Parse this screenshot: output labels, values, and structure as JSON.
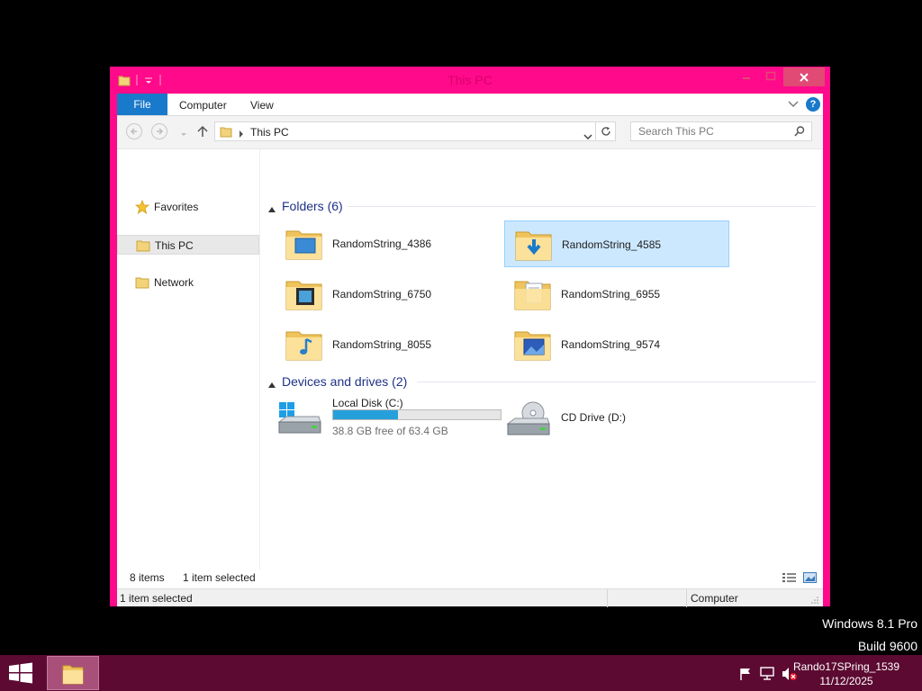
{
  "window": {
    "title": "This PC",
    "colors": {
      "frame": "#ff0a8a",
      "accent": "#1979ca",
      "selection": "#cce8ff"
    }
  },
  "ribbon": {
    "tabs": [
      {
        "label": "File",
        "active": true
      },
      {
        "label": "Computer"
      },
      {
        "label": "View"
      }
    ],
    "help_icon": "?"
  },
  "navbar": {
    "address": "This PC",
    "search_placeholder": "Search This PC"
  },
  "navpane": {
    "items": [
      {
        "label": "Favorites",
        "icon": "star-icon"
      },
      {
        "label": "This PC",
        "icon": "folder-icon",
        "selected": true
      },
      {
        "label": "Network",
        "icon": "folder-icon"
      }
    ]
  },
  "content": {
    "folders_group": {
      "title": "Folders (6)"
    },
    "folders": [
      {
        "name": "RandomString_4386",
        "icon": "desktop-folder-icon"
      },
      {
        "name": "RandomString_4585",
        "icon": "downloads-folder-icon",
        "selected": true
      },
      {
        "name": "RandomString_6750",
        "icon": "videos-folder-icon"
      },
      {
        "name": "RandomString_6955",
        "icon": "documents-folder-icon"
      },
      {
        "name": "RandomString_8055",
        "icon": "music-folder-icon"
      },
      {
        "name": "RandomString_9574",
        "icon": "pictures-folder-icon"
      }
    ],
    "drives_group": {
      "title": "Devices and drives (2)"
    },
    "drives": [
      {
        "name": "Local Disk (C:)",
        "free_text": "38.8 GB free of 63.4 GB",
        "used_fraction": 0.388,
        "icon": "hard-drive-icon"
      },
      {
        "name": "CD Drive (D:)",
        "icon": "cd-drive-icon"
      }
    ]
  },
  "countbar": {
    "items": "8 items",
    "selected": "1 item selected"
  },
  "statusbar": {
    "left": "1 item selected",
    "right": "Computer"
  },
  "desktop": {
    "edition": "Windows 8.1 Pro",
    "build": "Build 9600"
  },
  "taskbar": {
    "user": "Rando17SPring_1539",
    "date": "11/12/2025"
  }
}
